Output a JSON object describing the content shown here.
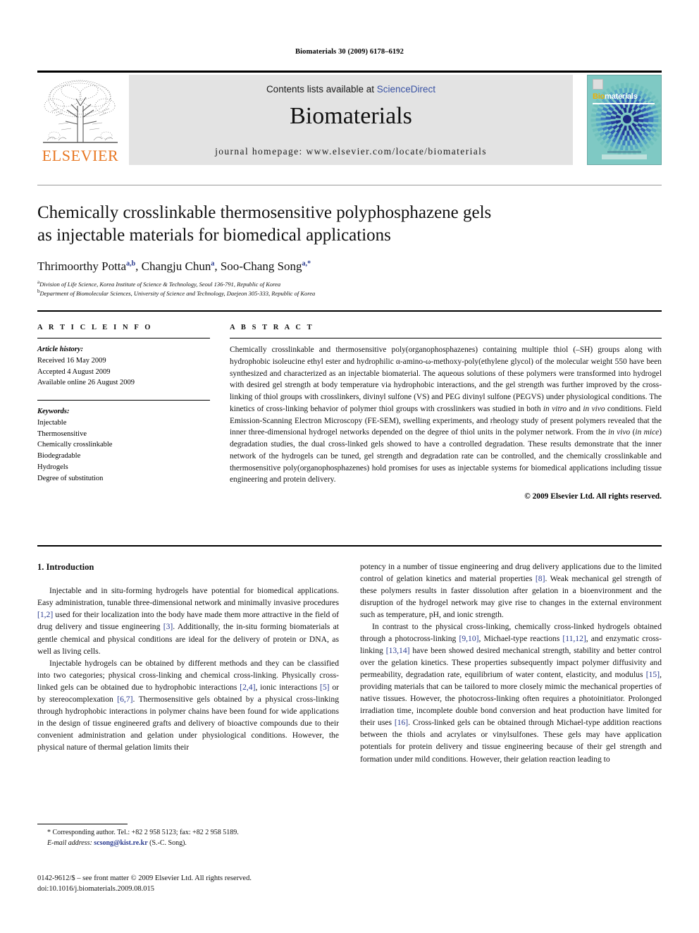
{
  "running_head": "Biomaterials 30 (2009) 6178–6192",
  "masthead": {
    "publisher_name": "ELSEVIER",
    "contents_prefix": "Contents lists available at ",
    "contents_link": "ScienceDirect",
    "journal_name": "Biomaterials",
    "homepage": "journal homepage: www.elsevier.com/locate/biomaterials",
    "cover_title_bio": "Bio",
    "cover_title_rest": "materials",
    "link_color": "#3a53a4",
    "brand_color": "#E87722",
    "cover_bg": "#7fc9c4"
  },
  "article": {
    "title_line1": "Chemically crosslinkable thermosensitive polyphosphazene gels",
    "title_line2": "as injectable materials for biomedical applications",
    "authors": [
      {
        "name": "Thrimoorthy Potta",
        "marks": "a,b",
        "sep": ", "
      },
      {
        "name": "Changju Chun",
        "marks": "a",
        "sep": ", "
      },
      {
        "name": "Soo-Chang Song",
        "marks": "a,*",
        "sep": ""
      }
    ],
    "affiliations": [
      {
        "mark": "a",
        "text": "Division of Life Science, Korea Institute of Science & Technology, Seoul 136-791, Republic of Korea"
      },
      {
        "mark": "b",
        "text": "Department of Biomolecular Sciences, University of Science and Technology, Daejeon 305-333, Republic of Korea"
      }
    ]
  },
  "article_info": {
    "heading": "A R T I C L E  I N F O",
    "history_label": "Article history:",
    "history": [
      "Received 16 May 2009",
      "Accepted 4 August 2009",
      "Available online 26 August 2009"
    ],
    "keywords_label": "Keywords:",
    "keywords": [
      "Injectable",
      "Thermosensitive",
      "Chemically crosslinkable",
      "Biodegradable",
      "Hydrogels",
      "Degree of substitution"
    ]
  },
  "abstract": {
    "heading": "A B S T R A C T",
    "part1": "Chemically crosslinkable and thermosensitive poly(organophosphazenes) containing multiple thiol (–SH) groups along with hydrophobic isoleucine ethyl ester and hydrophilic α-amino-ω-methoxy-poly(ethylene glycol) of the molecular weight 550 have been synthesized and characterized as an injectable biomaterial. The aqueous solutions of these polymers were transformed into hydrogel with desired gel strength at body temperature via hydrophobic interactions, and the gel strength was further improved by the cross-linking of thiol groups with crosslinkers, divinyl sulfone (VS) and PEG divinyl sulfone (PEGVS) under physiological conditions. The kinetics of cross-linking behavior of polymer thiol groups with crosslinkers was studied in both ",
    "ital1": "in vitro",
    "part2": " and ",
    "ital2": "in vivo",
    "part3": " conditions. Field Emission-Scanning Electron Microscopy (FE-SEM), swelling experiments, and rheology study of present polymers revealed that the inner three-dimensional hydrogel networks depended on the degree of thiol units in the polymer network. From the ",
    "ital3": "in vivo",
    "part4": " (",
    "ital4": "in mice",
    "part5": ") degradation studies, the dual cross-linked gels showed to have a controlled degradation. These results demonstrate that the inner network of the hydrogels can be tuned, gel strength and degradation rate can be controlled, and the chemically crosslinkable and thermosensitive poly(organophosphazenes) hold promises for uses as injectable systems for biomedical applications including tissue engineering and protein delivery.",
    "copyright": "© 2009 Elsevier Ltd. All rights reserved."
  },
  "body": {
    "section_heading": "1. Introduction",
    "left_p1_a": "Injectable and in situ-forming hydrogels have potential for biomedical applications. Easy administration, tunable three-dimensional network and minimally invasive procedures ",
    "left_p1_r1": "[1,2]",
    "left_p1_b": " used for their localization into the body have made them more attractive in the field of drug delivery and tissue engineering ",
    "left_p1_r2": "[3]",
    "left_p1_c": ". Additionally, the in-situ forming biomaterials at gentle chemical and physical conditions are ideal for the delivery of protein or DNA, as well as living cells.",
    "left_p2_a": "Injectable hydrogels can be obtained by different methods and they can be classified into two categories; physical cross-linking and chemical cross-linking. Physically cross-linked gels can be obtained due to hydrophobic interactions ",
    "left_p2_r1": "[2,4]",
    "left_p2_b": ", ionic interactions ",
    "left_p2_r2": "[5]",
    "left_p2_c": " or by stereocomplexation ",
    "left_p2_r3": "[6,7]",
    "left_p2_d": ". Thermosensitive gels obtained by a physical cross-linking through hydrophobic interactions in polymer chains have been found for wide applications in the design of tissue engineered grafts and delivery of bioactive compounds due to their convenient administration and gelation under physiological conditions. However, the physical nature of thermal gelation limits their",
    "right_p1_a": "potency in a number of tissue engineering and drug delivery applications due to the limited control of gelation kinetics and material properties ",
    "right_p1_r1": "[8]",
    "right_p1_b": ". Weak mechanical gel strength of these polymers results in faster dissolution after gelation in a bioenvironment and the disruption of the hydrogel network may give rise to changes in the external environment such as temperature, pH, and ionic strength.",
    "right_p2_a": "In contrast to the physical cross-linking, chemically cross-linked hydrogels obtained through a photocross-linking ",
    "right_p2_r1": "[9,10]",
    "right_p2_b": ", Michael-type reactions ",
    "right_p2_r2": "[11,12]",
    "right_p2_c": ", and enzymatic cross-linking ",
    "right_p2_r3": "[13,14]",
    "right_p2_d": " have been showed desired mechanical strength, stability and better control over the gelation kinetics. These properties subsequently impact polymer diffusivity and permeability, degradation rate, equilibrium of water content, elasticity, and modulus ",
    "right_p2_r4": "[15]",
    "right_p2_e": ", providing materials that can be tailored to more closely mimic the mechanical properties of native tissues. However, the photocross-linking often requires a photoinitiator. Prolonged irradiation time, incomplete double bond conversion and heat production have limited for their uses ",
    "right_p2_r5": "[16]",
    "right_p2_f": ". Cross-linked gels can be obtained through Michael-type addition reactions between the thiols and acrylates or vinylsulfones. These gels may have application potentials for protein delivery and tissue engineering because of their gel strength and formation under mild conditions. However, their gelation reaction leading to"
  },
  "footnote": {
    "star": "*",
    "corresponding": " Corresponding author. Tel.: +82 2 958 5123; fax: +82 2 958 5189.",
    "email_label": "E-mail address:",
    "email": "scsong@kist.re.kr",
    "email_suffix": " (S.-C. Song)."
  },
  "footer": {
    "line1": "0142-9612/$ – see front matter © 2009 Elsevier Ltd. All rights reserved.",
    "line2": "doi:10.1016/j.biomaterials.2009.08.015"
  }
}
